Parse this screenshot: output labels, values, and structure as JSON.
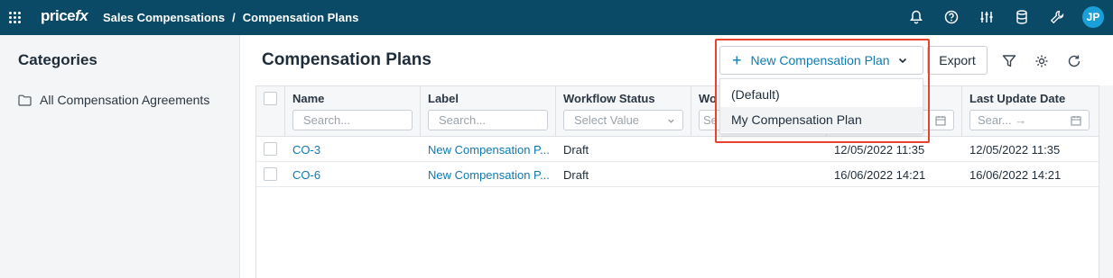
{
  "header": {
    "logo": {
      "part1": "price",
      "part2": "fx"
    },
    "breadcrumb": [
      "Sales Compensations",
      "/",
      "Compensation Plans"
    ],
    "avatar_initials": "JP",
    "icons": [
      "bell-icon",
      "help-icon",
      "sliders-icon",
      "database-icon",
      "tools-icon"
    ],
    "bar_color": "#0a4a66"
  },
  "sidebar": {
    "title": "Categories",
    "items": [
      {
        "label": "All Compensation Agreements",
        "icon": "folder-icon"
      }
    ]
  },
  "main": {
    "title": "Compensation Plans",
    "new_button_label": "New Compensation Plan",
    "export_label": "Export",
    "dropdown": {
      "items": [
        "(Default)",
        "My Compensation Plan"
      ]
    },
    "columns": [
      {
        "label": "Name",
        "filter": "Search..."
      },
      {
        "label": "Label",
        "filter": "Search..."
      },
      {
        "label": "Workflow Status",
        "filter": "Select Value"
      },
      {
        "label": "Wo",
        "filter": "Se"
      },
      {
        "label": "",
        "filter": ""
      },
      {
        "label": "Last Update Date",
        "filter": "Sear...  →"
      }
    ],
    "rows": [
      {
        "name": "CO-3",
        "label": "New Compensation P...",
        "status": "Draft",
        "created": "12/05/2022 11:35",
        "updated": "12/05/2022 11:35"
      },
      {
        "name": "CO-6",
        "label": "New Compensation P...",
        "status": "Draft",
        "created": "16/06/2022 14:21",
        "updated": "16/06/2022 14:21"
      }
    ]
  },
  "colors": {
    "accent": "#0c7bb3",
    "highlight_border": "#e8432f"
  }
}
